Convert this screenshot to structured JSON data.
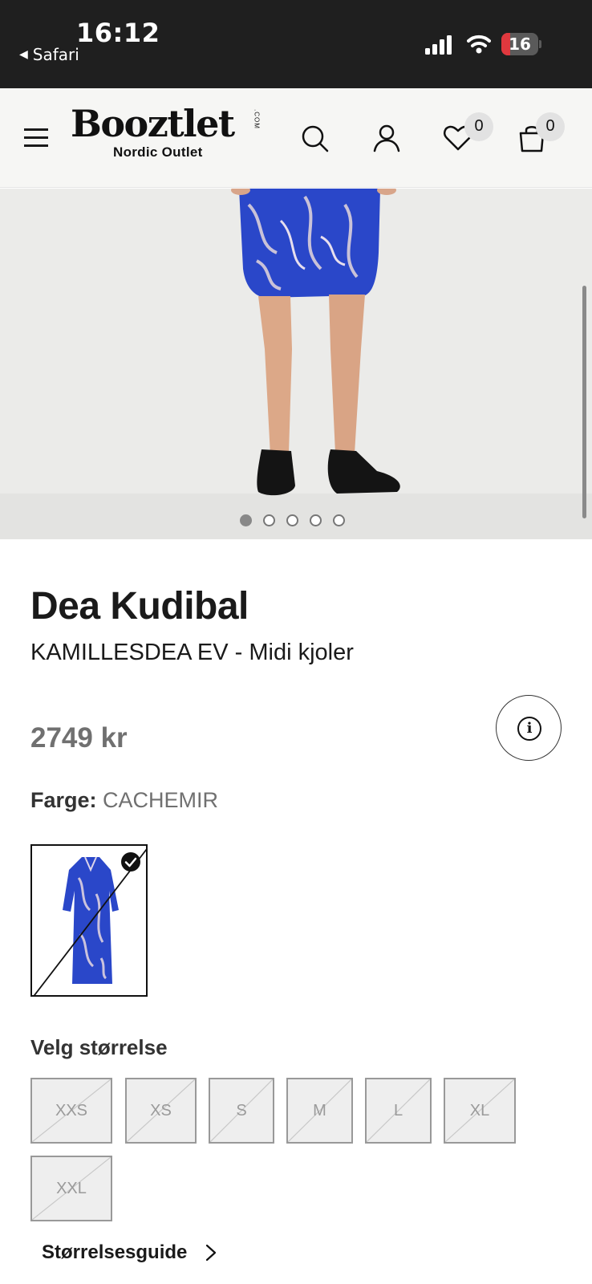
{
  "status_bar": {
    "time": "16:12",
    "back_label": "Safari",
    "battery": "16"
  },
  "header": {
    "logo": "Booztlet",
    "logo_com": ".COM",
    "logo_sub": "Nordic Outlet",
    "wishlist_count": "0",
    "cart_count": "0"
  },
  "gallery": {
    "image_count": 5,
    "active_index": 0
  },
  "product": {
    "brand": "Dea Kudibal",
    "name": "KAMILLESDEA EV - Midi kjoler",
    "price": "2749 kr",
    "color_label": "Farge:",
    "color_value": "CACHEMIR"
  },
  "sizes": {
    "title": "Velg størrelse",
    "options": [
      "XXS",
      "XS",
      "S",
      "M",
      "L",
      "XL",
      "XXL"
    ],
    "guide_label": "Størrelsesguide"
  },
  "colors": {
    "primary_dress": "#2a47c9",
    "header_bg": "#f6f6f4",
    "status_bg": "#1f1f1f"
  }
}
